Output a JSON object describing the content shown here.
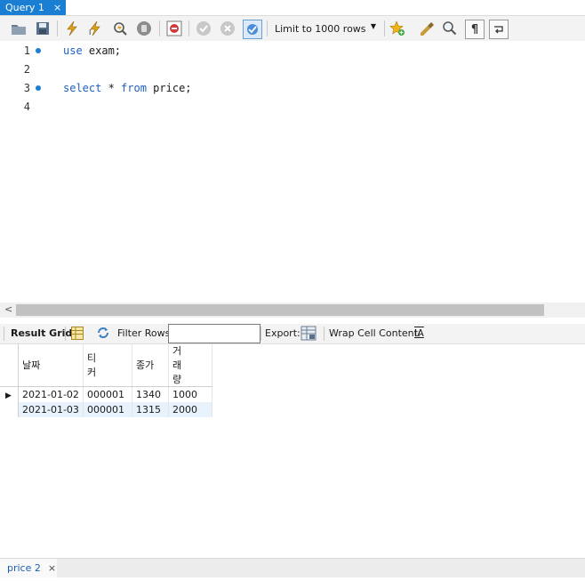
{
  "tab": {
    "title": "Query 1",
    "close": "×"
  },
  "toolbar": {
    "limit_label": "Limit to 1000 rows"
  },
  "editor": {
    "lines": [
      {
        "num": "1",
        "text": "use exam;"
      },
      {
        "num": "2",
        "text": ""
      },
      {
        "num": "3",
        "text": "select * from price;"
      },
      {
        "num": "4",
        "text": ""
      }
    ]
  },
  "result_toolbar": {
    "result_grid": "Result Grid",
    "filter_rows": "Filter Rows:",
    "export": "Export:",
    "wrap": "Wrap Cell Content:",
    "wrap_icon": "IA"
  },
  "grid": {
    "headers": [
      "날짜",
      "티\n커",
      "종가",
      "거\n래\n량"
    ],
    "rows": [
      [
        "2021-01-02",
        "000001",
        "1340",
        "1000"
      ],
      [
        "2021-01-03",
        "000001",
        "1315",
        "2000"
      ]
    ]
  },
  "bottom_tab": {
    "title": "price 2",
    "close": "×"
  },
  "colors": {
    "accent": "#1a7fd3",
    "alt_row": "#e8f2fd"
  }
}
